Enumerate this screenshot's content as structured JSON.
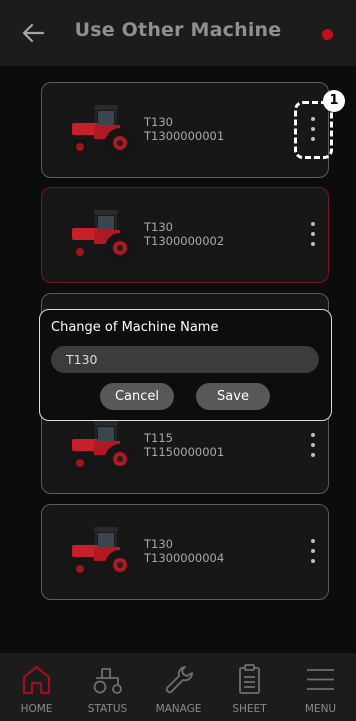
{
  "header": {
    "title": "Use Other Machine"
  },
  "machines": [
    {
      "model": "T130",
      "serial": "T1300000001"
    },
    {
      "model": "T130",
      "serial": "T1300000002"
    },
    {
      "model": "T115",
      "serial": "T1150000001"
    },
    {
      "model": "T130",
      "serial": "T1300000004"
    }
  ],
  "callout": {
    "number": "1"
  },
  "dialog": {
    "title": "Change of Machine Name",
    "input_value": "T130",
    "cancel_label": "Cancel",
    "save_label": "Save"
  },
  "nav": {
    "items": [
      {
        "label": "HOME",
        "icon": "home-icon"
      },
      {
        "label": "STATUS",
        "icon": "tractor-icon"
      },
      {
        "label": "MANAGE",
        "icon": "wrench-icon"
      },
      {
        "label": "SHEET",
        "icon": "clipboard-icon"
      },
      {
        "label": "MENU",
        "icon": "hamburger-icon"
      }
    ]
  },
  "colors": {
    "accent": "#c2101f",
    "selected_border": "#7a1420",
    "background": "#0c0c0c",
    "bar": "#1c1c1c"
  }
}
